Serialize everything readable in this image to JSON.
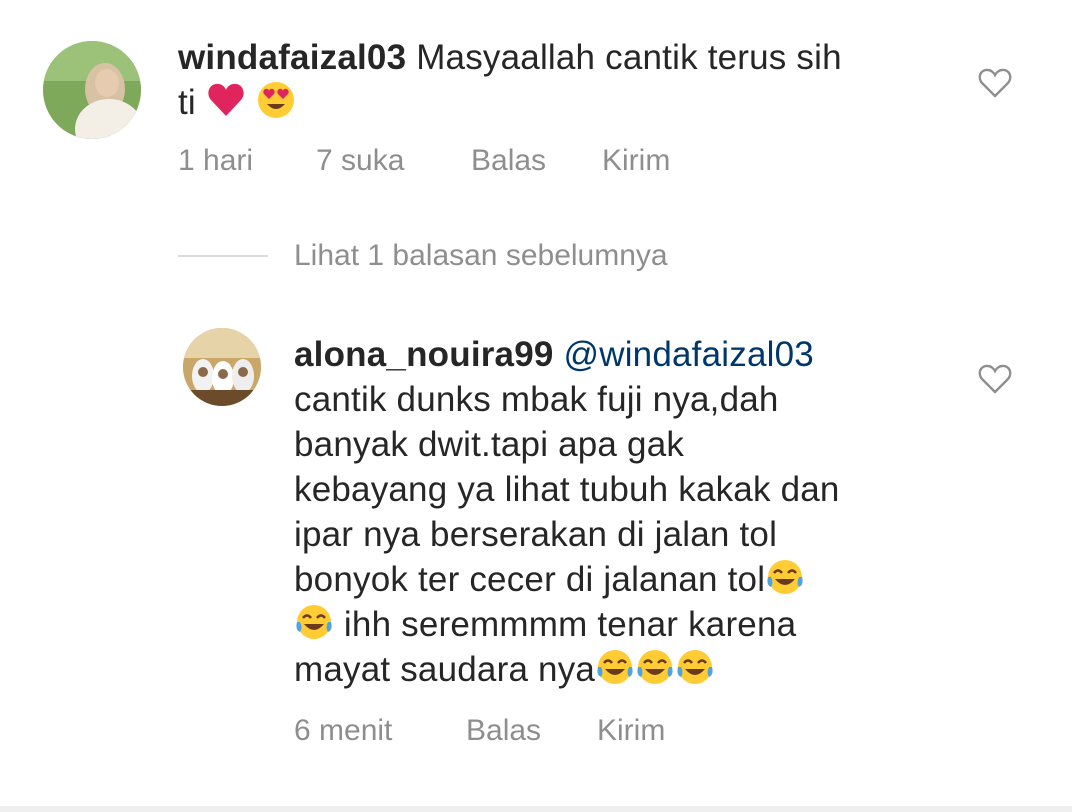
{
  "comments": [
    {
      "username": "windafaizal03",
      "text_line1": "Masyaallah cantik terus sih",
      "text_line2": "ti",
      "emoji_names": [
        "red-heart-emoji",
        "heart-eyes-emoji"
      ],
      "time": "1 hari",
      "likes": "7 suka",
      "reply_label": "Balas",
      "send_label": "Kirim"
    },
    {
      "username": "alona_nouira99",
      "mention": "@windafaizal03",
      "lines": [
        "cantik dunks mbak fuji nya,dah",
        "banyak dwit.tapi apa gak",
        "kebayang ya lihat tubuh kakak dan",
        "ipar nya berserakan di jalan tol",
        "bonyok ter cecer di jalanan tol",
        " ihh seremmmm tenar karena",
        "mayat saudara nya"
      ],
      "emoji_names": [
        "tears-of-joy-emoji"
      ],
      "time": "6 menit",
      "reply_label": "Balas",
      "send_label": "Kirim"
    }
  ],
  "replies_toggle": {
    "label": "Lihat 1 balasan sebelumnya"
  },
  "colors": {
    "text": "#262626",
    "secondary": "#8e8e8e",
    "mention": "#00376b",
    "heart_red": "#e0245e"
  }
}
